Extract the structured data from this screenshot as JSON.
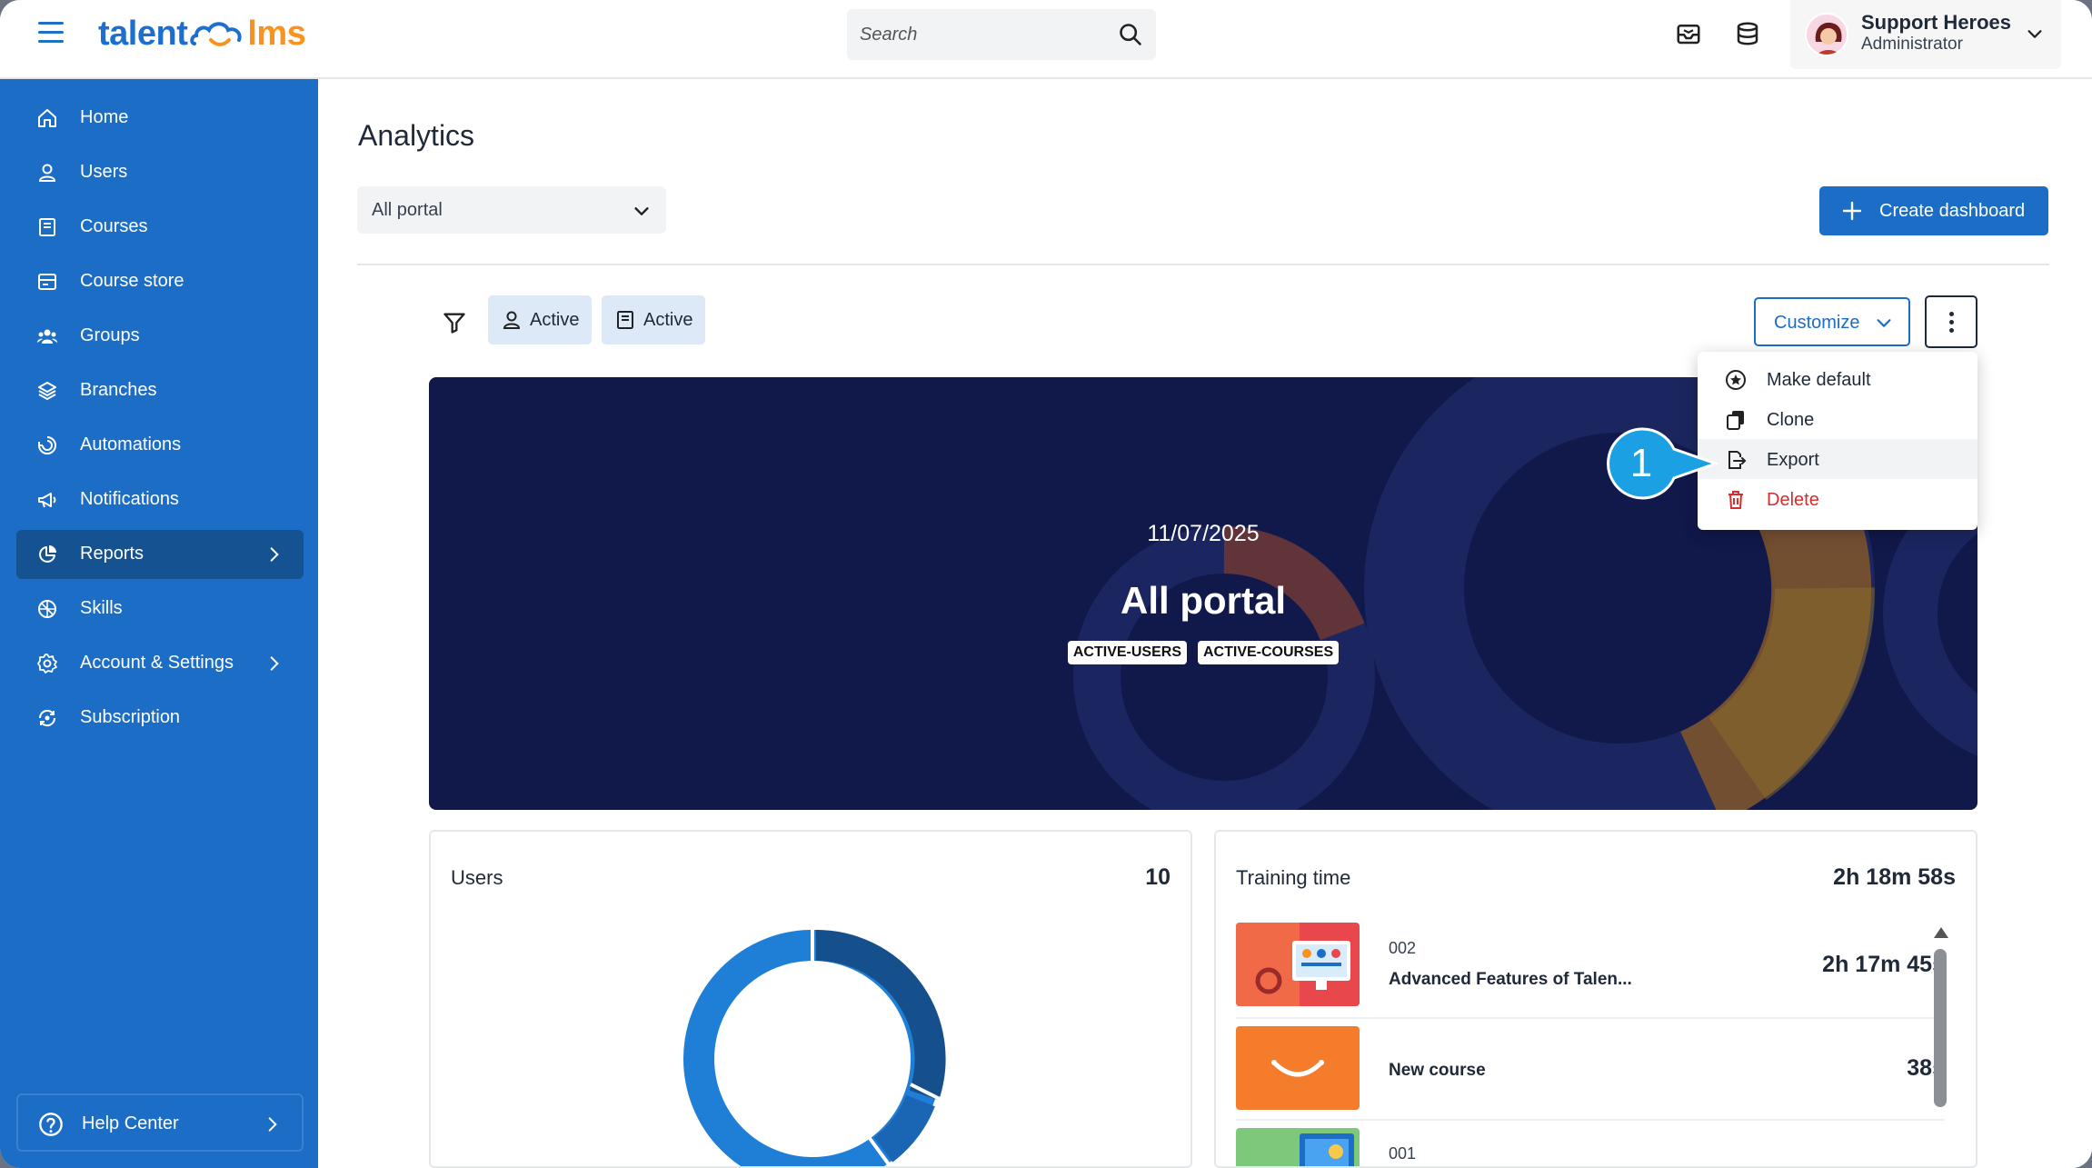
{
  "header": {
    "logo_left": "talent",
    "logo_right": "lms",
    "search_placeholder": "Search",
    "user": {
      "name": "Support Heroes",
      "role": "Administrator"
    }
  },
  "sidebar": {
    "items": [
      {
        "label": "Home",
        "icon": "home-icon"
      },
      {
        "label": "Users",
        "icon": "user-icon"
      },
      {
        "label": "Courses",
        "icon": "book-icon"
      },
      {
        "label": "Course store",
        "icon": "store-icon"
      },
      {
        "label": "Groups",
        "icon": "groups-icon"
      },
      {
        "label": "Branches",
        "icon": "layers-icon"
      },
      {
        "label": "Automations",
        "icon": "automations-icon"
      },
      {
        "label": "Notifications",
        "icon": "megaphone-icon"
      },
      {
        "label": "Reports",
        "icon": "pie-chart-icon",
        "active": true
      },
      {
        "label": "Skills",
        "icon": "skills-icon"
      },
      {
        "label": "Account & Settings",
        "icon": "gear-icon"
      },
      {
        "label": "Subscription",
        "icon": "subscription-icon"
      }
    ],
    "help_label": "Help Center"
  },
  "main": {
    "title": "Analytics",
    "portal_select": "All portal",
    "create_button": "Create dashboard",
    "filters": {
      "users_chip": "Active",
      "courses_chip": "Active"
    },
    "customize_label": "Customize"
  },
  "menu": {
    "items": [
      {
        "label": "Make default"
      },
      {
        "label": "Clone"
      },
      {
        "label": "Export"
      },
      {
        "label": "Delete"
      }
    ]
  },
  "callout": {
    "number": "1"
  },
  "hero": {
    "date": "11/07/2025",
    "title": "All portal",
    "tags": [
      "ACTIVE-USERS",
      "ACTIVE-COURSES"
    ]
  },
  "cards": {
    "users": {
      "title": "Users",
      "value": "10"
    },
    "training": {
      "title": "Training time",
      "value": "2h 18m 58s",
      "courses": [
        {
          "code": "002",
          "name": "Advanced Features of Talen...",
          "time": "2h 17m 45s"
        },
        {
          "code": "",
          "name": "New course",
          "time": "38s"
        },
        {
          "code": "001",
          "name": "",
          "time": ""
        }
      ]
    }
  },
  "colors": {
    "primary": "#1c6dc6",
    "sidebar_active": "#155291",
    "hero_bg": "#11184a",
    "danger": "#d62d2d",
    "accent": "#f7931e"
  }
}
